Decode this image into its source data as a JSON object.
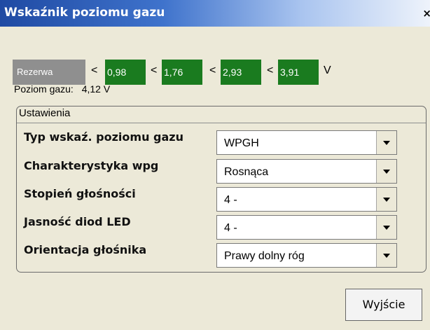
{
  "window": {
    "title": "Wskaźnik poziomu gazu",
    "close_symbol": "×"
  },
  "thresholds": {
    "reserve_label": "Rezerwa",
    "separator": "<",
    "values": [
      "0,98",
      "1,76",
      "2,93",
      "3,91"
    ],
    "unit": "V",
    "colors": {
      "reserve_bg": "#8f8f8f",
      "value_bg": "#1a7b1f"
    }
  },
  "gas_level": {
    "label": "Poziom gazu:",
    "value": "4,12 V"
  },
  "settings": {
    "group_title": "Ustawienia",
    "rows": [
      {
        "label": "Typ wskaź. poziomu gazu",
        "value": "WPGH"
      },
      {
        "label": "Charakterystyka wpg",
        "value": "Rosnąca"
      },
      {
        "label": "Stopień głośności",
        "value": "4 -"
      },
      {
        "label": "Jasność diod LED",
        "value": "4 -"
      },
      {
        "label": "Orientacja głośnika",
        "value": "Prawy dolny róg"
      }
    ]
  },
  "actions": {
    "exit_label": "Wyjście"
  }
}
